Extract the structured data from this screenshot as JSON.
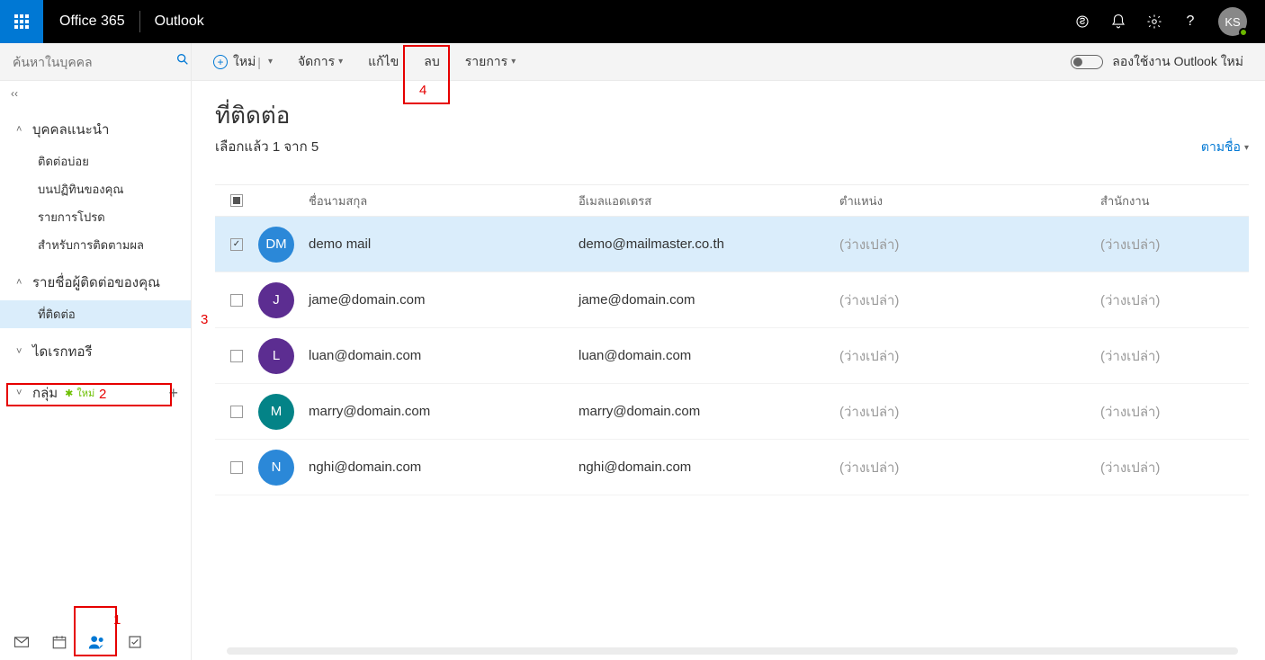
{
  "top": {
    "brand": "Office 365",
    "app": "Outlook",
    "avatar": "KS"
  },
  "search": {
    "placeholder": "ค้นหาในบุคคล"
  },
  "toolbar": {
    "new": "ใหม่",
    "manage": "จัดการ",
    "edit": "แก้ไข",
    "delete": "ลบ",
    "list": "รายการ",
    "try": "ลองใช้งาน Outlook ใหม่"
  },
  "sidebar": {
    "sec1": "บุคคลแนะนำ",
    "s1items": [
      "ติดต่อบ่อย",
      "บนปฏิทินของคุณ",
      "รายการโปรด",
      "สำหรับการติดตามผล"
    ],
    "sec2": "รายชื่อผู้ติดต่อของคุณ",
    "s2items": [
      "ที่ติดต่อ"
    ],
    "sec3": "ไดเรกทอรี",
    "sec4": "กลุ่ม",
    "newBadge": "ใหม่"
  },
  "page": {
    "title": "ที่ติดต่อ",
    "subtitle": "เลือกแล้ว 1 จาก 5",
    "sort": "ตามชื่อ"
  },
  "headers": {
    "name": "ชื่อนามสกุล",
    "email": "อีเมลแอดเดรส",
    "position": "ตำแหน่ง",
    "office": "สำนักงาน"
  },
  "empty": "(ว่างเปล่า)",
  "rows": [
    {
      "sel": true,
      "init": "DM",
      "color": "#2b88d8",
      "name": "demo mail",
      "email": "demo@mailmaster.co.th"
    },
    {
      "sel": false,
      "init": "J",
      "color": "#5c2d91",
      "name": "jame@domain.com",
      "email": "jame@domain.com"
    },
    {
      "sel": false,
      "init": "L",
      "color": "#5c2d91",
      "name": "luan@domain.com",
      "email": "luan@domain.com"
    },
    {
      "sel": false,
      "init": "M",
      "color": "#038387",
      "name": "marry@domain.com",
      "email": "marry@domain.com"
    },
    {
      "sel": false,
      "init": "N",
      "color": "#2b88d8",
      "name": "nghi@domain.com",
      "email": "nghi@domain.com"
    }
  ],
  "anno": {
    "1": "1",
    "2": "2",
    "3": "3",
    "4": "4"
  }
}
